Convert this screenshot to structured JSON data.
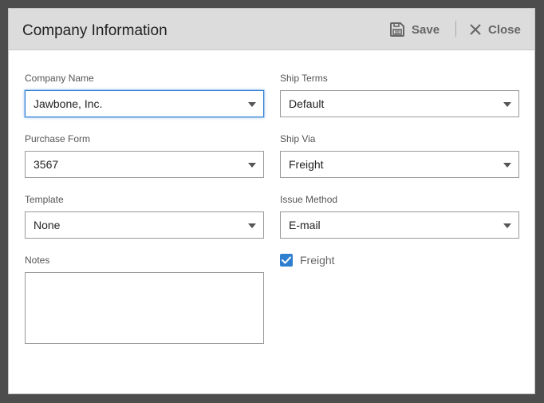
{
  "dialog": {
    "title": "Company Information",
    "save_label": "Save",
    "close_label": "Close"
  },
  "fields": {
    "company_name": {
      "label": "Company Name",
      "value": "Jawbone, Inc."
    },
    "ship_terms": {
      "label": "Ship Terms",
      "value": "Default"
    },
    "purchase_form": {
      "label": "Purchase Form",
      "value": "3567"
    },
    "ship_via": {
      "label": "Ship Via",
      "value": "Freight"
    },
    "template": {
      "label": "Template",
      "value": "None"
    },
    "issue_method": {
      "label": "Issue Method",
      "value": "E-mail"
    },
    "notes": {
      "label": "Notes",
      "value": ""
    },
    "freight": {
      "label": "Freight",
      "checked": true
    }
  },
  "colors": {
    "accent": "#2f7fd1",
    "header_bg": "#dcdcdc",
    "overlay": "#4d4d4d"
  },
  "icons": [
    "save-icon",
    "close-icon",
    "chevron-down-icon",
    "check-icon"
  ]
}
